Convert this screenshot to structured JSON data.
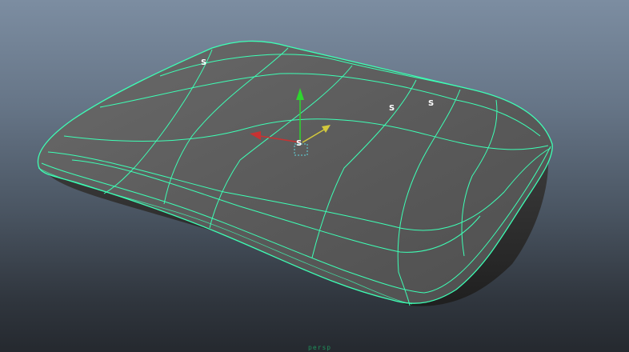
{
  "viewport": {
    "background_top": "#7c8da1",
    "background_bottom": "#25292f",
    "camera_label": "persp"
  },
  "mesh": {
    "name": "pillow",
    "selection_color": "#3dffb5",
    "surface_color": "#5a5a5a"
  },
  "vertex_labels": [
    "S",
    "S",
    "S",
    "S"
  ],
  "manipulator": {
    "y_axis_color": "#2fd52f",
    "x_axis_color": "#c83232",
    "z_axis_color": "#d2c83c",
    "pivot_label": "S"
  }
}
